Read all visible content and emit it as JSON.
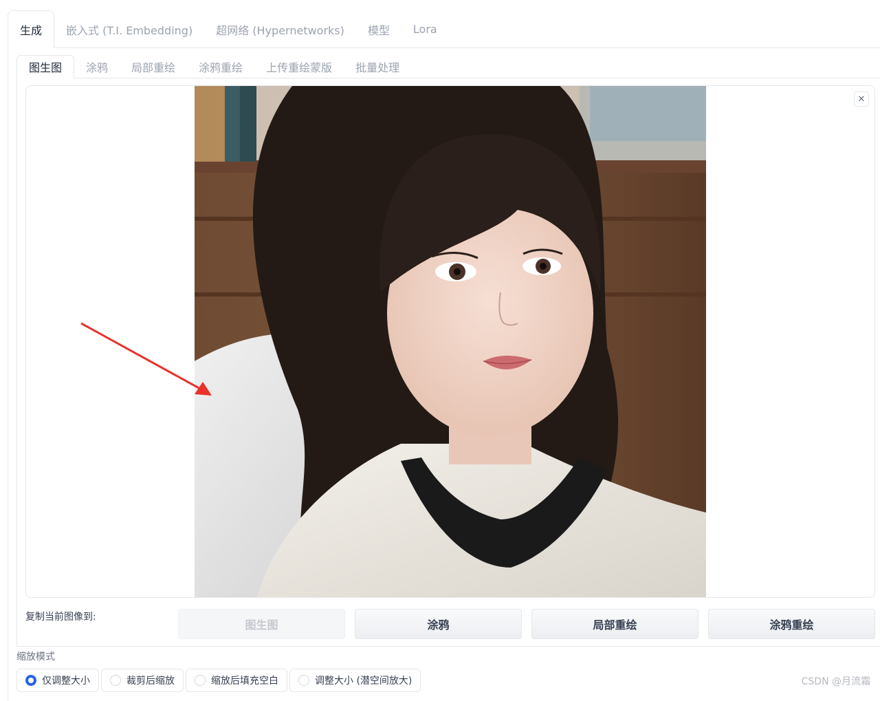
{
  "top_tabs": [
    "生成",
    "嵌入式 (T.I. Embedding)",
    "超网络 (Hypernetworks)",
    "模型",
    "Lora"
  ],
  "sub_tabs": [
    "图生图",
    "涂鸦",
    "局部重绘",
    "涂鸦重绘",
    "上传重绘蒙版",
    "批量处理"
  ],
  "image_area": {
    "close_icon": "close-icon",
    "close_glyph": "✕"
  },
  "copy_to": {
    "label": "复制当前图像到:",
    "buttons": [
      "图生图",
      "涂鸦",
      "局部重绘",
      "涂鸦重绘"
    ]
  },
  "resize_mode": {
    "title": "缩放模式",
    "options": [
      "仅调整大小",
      "裁剪后缩放",
      "缩放后填充空白",
      "调整大小 (潜空间放大)"
    ],
    "selected": "仅调整大小"
  },
  "watermark": "CSDN @月流霜",
  "colors": {
    "accent": "#2563eb",
    "annotation_arrow": "#e8322b"
  }
}
